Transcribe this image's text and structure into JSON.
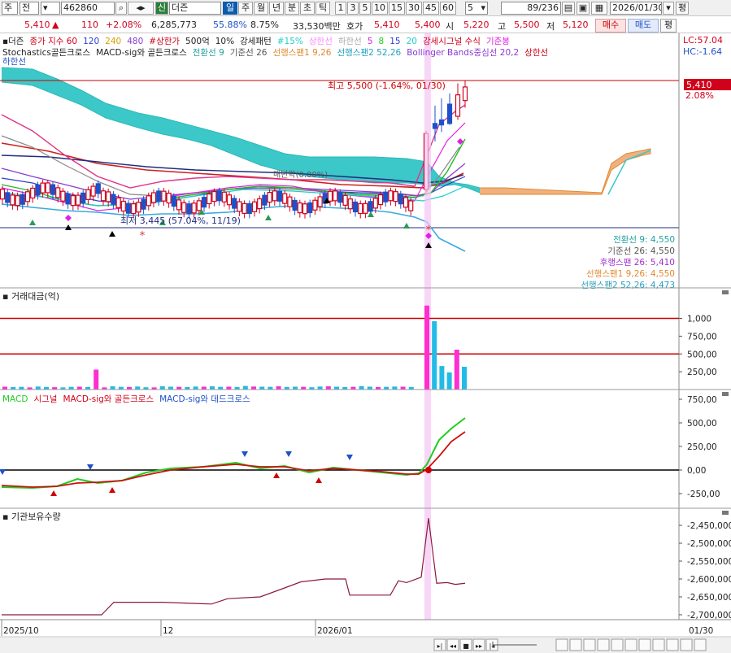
{
  "toolbar1": {
    "menu1": "주",
    "menu2": "전",
    "code": "462860",
    "badge": "신",
    "name": "더즌",
    "period_tabs": [
      "일",
      "주",
      "월",
      "년",
      "분",
      "초",
      "틱"
    ],
    "active_tab": "일",
    "intervals": [
      "1",
      "3",
      "5",
      "10",
      "15",
      "30",
      "45",
      "60"
    ],
    "interval_value": "5",
    "count": "89/236",
    "date": "2026/01/30",
    "right_label": "평"
  },
  "toolbar2": {
    "price": "5,410",
    "change": "110",
    "change_pct": "+2.08%",
    "volume": "6,285,773",
    "ratio1": "55.88%",
    "ratio2": "8.75%",
    "amount": "33,530백만",
    "hoga_label": "호가",
    "hoga1": "5,410",
    "hoga2": "5,400",
    "open_label": "시",
    "open": "5,220",
    "high_label": "고",
    "high": "5,500",
    "low_label": "저",
    "low": "5,120",
    "buy": "매수",
    "sell": "매도"
  },
  "colors": {
    "up": "#d0021b",
    "down": "#1f50c8",
    "cloud": "#3cc8c8",
    "cloud_lag": "#f0a060",
    "macd": "#22cc22",
    "signal": "#cc1111",
    "volume_down": "#22bbe6",
    "volume_up": "#ff2ed0",
    "highlight": "#f5c4f5"
  },
  "chart_data": [
    {
      "type": "candlestick",
      "name": "price-panel",
      "legend_line1": [
        {
          "text": "더즌",
          "color": "#222"
        },
        {
          "text": "종가 지수 60",
          "color": "#d0021b"
        },
        {
          "text": "120",
          "color": "#2c3fd0"
        },
        {
          "text": "240",
          "color": "#d6a000"
        },
        {
          "text": "480",
          "color": "#8a3cd0"
        },
        {
          "text": "#상한가",
          "color": "#d0021b"
        },
        {
          "text": "500억",
          "color": "#222"
        },
        {
          "text": "10%",
          "color": "#222"
        },
        {
          "text": "강세패턴",
          "color": "#222"
        },
        {
          "text": "#15%",
          "color": "#22cccc"
        },
        {
          "text": "상한선",
          "color": "#ff88ff"
        },
        {
          "text": "하한선",
          "color": "#aaaaaa"
        },
        {
          "text": "5",
          "color": "#e020e0"
        },
        {
          "text": "8",
          "color": "#22cc22"
        },
        {
          "text": "15",
          "color": "#2c3fd0"
        },
        {
          "text": "20",
          "color": "#22cccc"
        },
        {
          "text": "강세시그널 수식",
          "color": "#d0021b"
        },
        {
          "text": "기준봉",
          "color": "#e020e0"
        }
      ],
      "legend_line2": [
        {
          "text": "Stochastics골든크로스",
          "color": "#222"
        },
        {
          "text": "MACD-sig와 골든크로스",
          "color": "#222"
        },
        {
          "text": "전환선 9",
          "color": "#22a0a0"
        },
        {
          "text": "기준선 26",
          "color": "#555"
        },
        {
          "text": "선행스팬1 9,26",
          "color": "#e08a30"
        },
        {
          "text": "선행스팬2 52,26",
          "color": "#22a0c0"
        },
        {
          "text": "Bollinger Bands중심선 20,2",
          "color": "#8a3cd0"
        },
        {
          "text": "상한선",
          "color": "#d0021b"
        }
      ],
      "legend_line3": "하한선",
      "lc": "LC:57.04",
      "hc": "HC:-1.64",
      "max_label": "최고 5,500 (-1.64%, 01/30)",
      "min_label": "최저 3,445 (57.04%, 11/19)",
      "ann_label": "매단락(0.00%)",
      "current_price": "5,410",
      "current_pct": "2.08%",
      "max": 5500,
      "min": 3445,
      "current": 5410,
      "ichimoku_labels": [
        {
          "text": "전환선 9: 4,550",
          "color": "#22a0a0"
        },
        {
          "text": "기준선 26: 4,550",
          "color": "#555555"
        },
        {
          "text": "후행스팬 26: 5,410",
          "color": "#a030d0"
        },
        {
          "text": "선행스팬1 9,26: 4,550",
          "color": "#e08a30"
        },
        {
          "text": "선행스팬2 52,26: 4,473",
          "color": "#22a0c0"
        }
      ]
    },
    {
      "type": "bar",
      "name": "volume-panel",
      "title": "거래대금(억)",
      "ticks": [
        "1,000",
        "750,00",
        "500,00",
        "250,00"
      ],
      "values": [
        40,
        35,
        38,
        30,
        42,
        36,
        33,
        30,
        38,
        40,
        35,
        280,
        30,
        45,
        38,
        36,
        42,
        32,
        30,
        45,
        40,
        38,
        35,
        42,
        40,
        45,
        38,
        40,
        35,
        50,
        42,
        40,
        38,
        45,
        36,
        40,
        38,
        32,
        42,
        45,
        40,
        35,
        38,
        48,
        40,
        35,
        38,
        42,
        40,
        36,
        1180,
        960,
        330,
        240,
        560,
        320
      ],
      "ref_lines": [
        1000,
        500
      ]
    },
    {
      "type": "line",
      "name": "macd-panel",
      "legend": [
        {
          "text": "MACD",
          "color": "#22cc22"
        },
        {
          "text": "시그널",
          "color": "#d0021b"
        },
        {
          "text": "MACD-sig와 골든크로스",
          "color": "#d0021b"
        },
        {
          "text": "MACD-sig와 데드크로스",
          "color": "#1f50c8"
        }
      ],
      "ticks": [
        "750,00",
        "500,00",
        "250,00",
        "0,00",
        "-250,00"
      ]
    },
    {
      "type": "line",
      "name": "inst-panel",
      "title": "기관보유수량",
      "ticks": [
        "-2,450,000",
        "-2,500,000",
        "-2,550,000",
        "-2,600,000",
        "-2,650,000",
        "-2,700,000"
      ],
      "x_labels": [
        "2025/10",
        "12",
        "2026/01"
      ],
      "x_right": "01/30"
    }
  ]
}
